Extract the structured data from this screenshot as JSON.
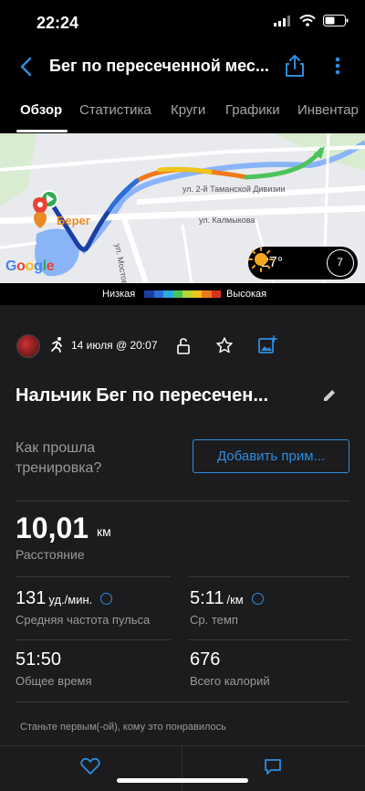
{
  "status_bar": {
    "time": "22:24"
  },
  "nav": {
    "title": "Бег по пересеченной мес..."
  },
  "tabs": [
    {
      "label": "Обзор"
    },
    {
      "label": "Статистика"
    },
    {
      "label": "Круги"
    },
    {
      "label": "Графики"
    },
    {
      "label": "Инвентар"
    }
  ],
  "map": {
    "streets": [
      "ул. 2-й Таманской Дивизии",
      "ул. Калмыкова",
      "ул. Мостовая"
    ],
    "place_label": "Берег",
    "logo_text": "Google"
  },
  "weather": {
    "temperature": "27°",
    "wind": "7"
  },
  "legend": {
    "low": "Низкая",
    "high": "Высокая",
    "colors": [
      "#1b3fa3",
      "#2b6fd6",
      "#2aa8e0",
      "#4cc35a",
      "#b8d534",
      "#f0c419",
      "#f07a1a",
      "#d6341f"
    ]
  },
  "activity": {
    "date": "14 июля @ 20:07",
    "title": "Нальчик Бег по пересечен...",
    "feel_question": "Как прошла тренировка?",
    "add_note_label": "Добавить прим..."
  },
  "stats": {
    "distance": {
      "value": "10,01",
      "unit": "км",
      "label": "Расстояние"
    },
    "avg_hr": {
      "value": "131",
      "unit": "уд./мин.",
      "label": "Средняя частота пульса"
    },
    "avg_pace": {
      "value": "5:11",
      "unit": "/км",
      "label": "Ср. темп"
    },
    "total_time": {
      "value": "51:50",
      "label": "Общее время"
    },
    "calories": {
      "value": "676",
      "label": "Всего калорий"
    }
  },
  "social": {
    "likes_text": "Станьте первым(-ой), кому это понравилось"
  },
  "colors": {
    "accent": "#2e8dde",
    "background": "#1c1c1e"
  }
}
